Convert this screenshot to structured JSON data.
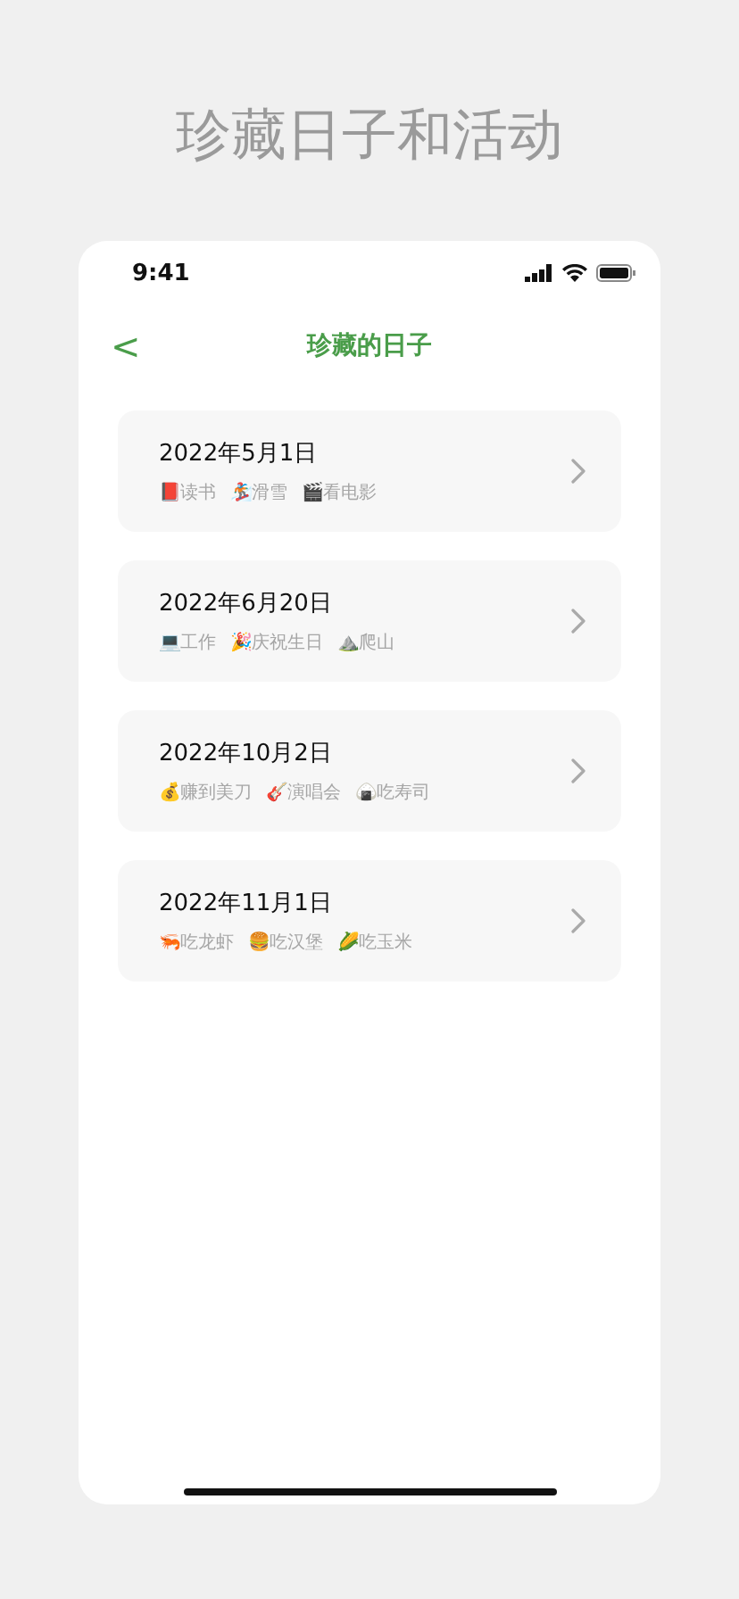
{
  "headline": "珍藏日子和活动",
  "status_bar": {
    "time": "9:41"
  },
  "nav": {
    "back": "<",
    "title": "珍藏的日子"
  },
  "days": [
    {
      "date": "2022年5月1日",
      "activities": [
        "📕读书",
        "🏂滑雪",
        "🎬看电影"
      ]
    },
    {
      "date": "2022年6月20日",
      "activities": [
        "💻工作",
        "🎉庆祝生日",
        "⛰️爬山"
      ]
    },
    {
      "date": "2022年10月2日",
      "activities": [
        "💰赚到美刀",
        "🎸演唱会",
        "🍙吃寿司"
      ]
    },
    {
      "date": "2022年11月1日",
      "activities": [
        "🦐吃龙虾",
        "🍔吃汉堡",
        "🌽吃玉米"
      ]
    }
  ]
}
